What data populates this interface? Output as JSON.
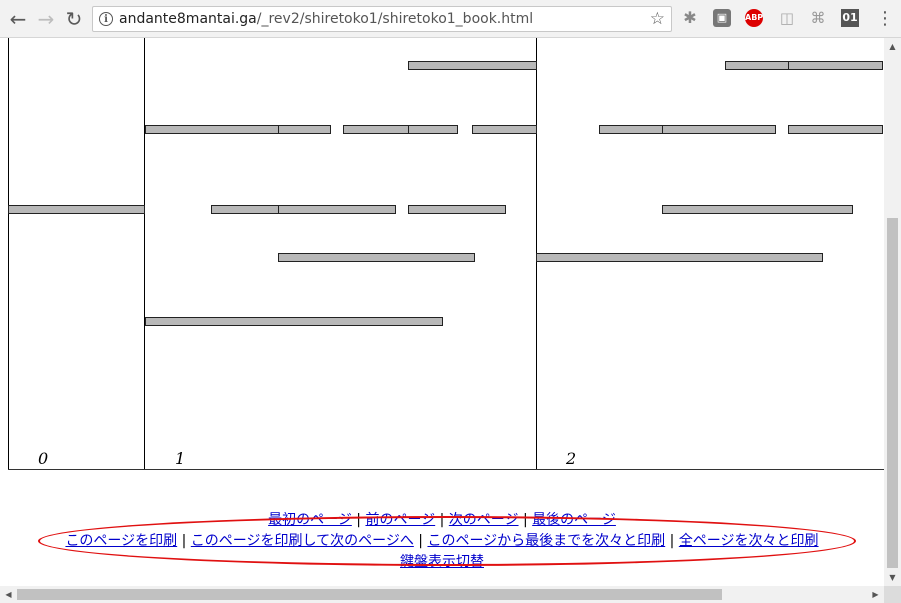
{
  "browser": {
    "url_host": "andante8mantai.ga",
    "url_path": "/_rev2/shiretoko1/shiretoko1_book.html",
    "back_icon": "←",
    "forward_icon": "→",
    "reload_icon": "↻",
    "info_icon": "i",
    "star_icon": "☆",
    "menu_icon": "⋮",
    "extensions": {
      "abp_label": "ABP",
      "counter_label": "01"
    }
  },
  "score": {
    "page_numbers": [
      "0",
      "1",
      "2"
    ]
  },
  "footer": {
    "nav_links": [
      "最初のページ",
      "前のページ",
      "次のページ",
      "最後のページ"
    ],
    "print_links": [
      "このページを印刷",
      "このページを印刷して次のページへ",
      "このページから最後までを次々と印刷",
      "全ページを次々と印刷"
    ],
    "separator": "|",
    "keyboard_toggle": "鍵盤表示切替"
  },
  "colors": {
    "link": "#0000cc",
    "highlight_ellipse": "#e01010",
    "bar_fill": "#b8b8b8"
  }
}
